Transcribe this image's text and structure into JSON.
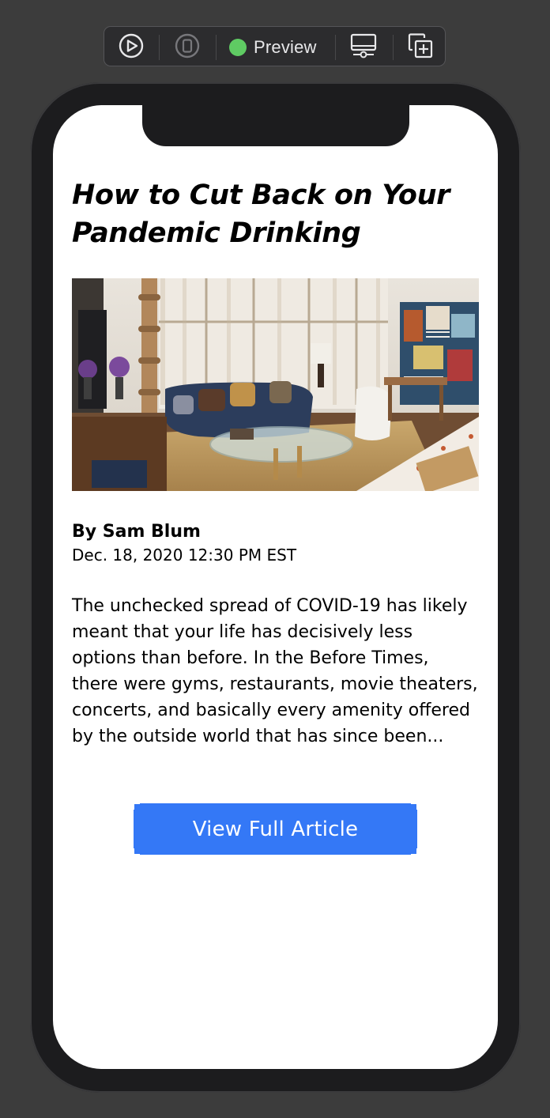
{
  "toolbar": {
    "preview_label": "Preview",
    "status_color": "#5fcb63",
    "icons": [
      "play-circle-icon",
      "device-live-icon",
      "device-settings-icon",
      "duplicate-preview-icon"
    ]
  },
  "article": {
    "title": "How to Cut Back on Your Pandemic Drinking",
    "image": "living-room-photo",
    "author": "By Sam Blum",
    "date": "Dec. 18, 2020 12:30 PM EST",
    "summary": "The unchecked spread of COVID-19 has likely meant that your life has decisively less options than before. In the Before Times, there were gyms, restaurants, movie theaters, concerts, and basically every amenity offered by the outside world that has since been...",
    "cta_label": "View Full Article",
    "cta_color": "#3478f6"
  }
}
